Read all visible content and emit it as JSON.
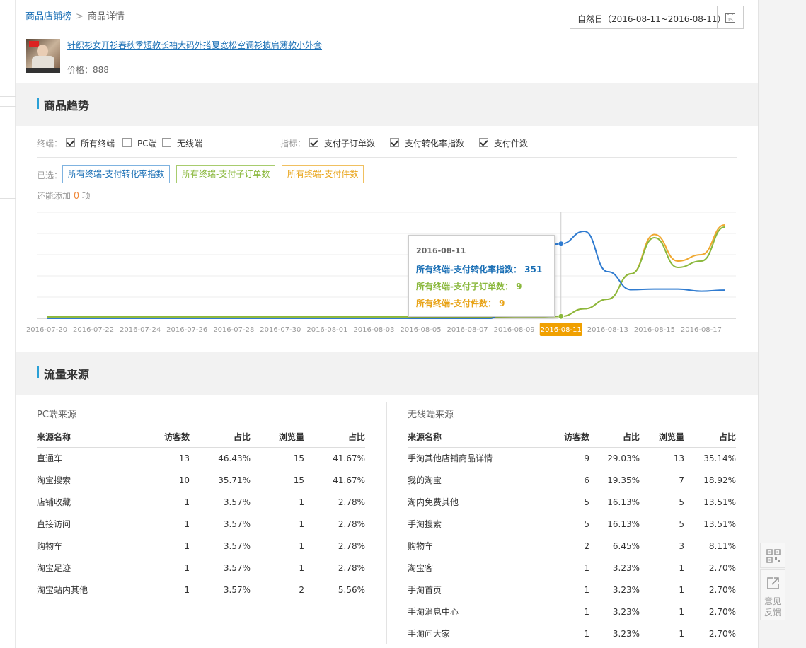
{
  "breadcrumb": {
    "root": "商品店铺榜",
    "current": "商品详情"
  },
  "date_range": "自然日（2016-08-11~2016-08-11）",
  "product": {
    "title": "针织衫女开衫春秋季短款长袖大码外搭夏宽松空调衫披肩薄款小外套",
    "price_label": "价格：",
    "price": "888"
  },
  "trend_section": {
    "title": "商品趋势"
  },
  "filters": {
    "terminal_label": "终端：",
    "terminals": [
      {
        "label": "所有终端",
        "checked": true
      },
      {
        "label": "PC端",
        "checked": false
      },
      {
        "label": "无线端",
        "checked": false
      }
    ],
    "metric_label": "指标：",
    "metrics": [
      {
        "label": "支付子订单数",
        "checked": true
      },
      {
        "label": "支付转化率指数",
        "checked": true
      },
      {
        "label": "支付件数",
        "checked": true
      }
    ]
  },
  "selected": {
    "label": "已选：",
    "tags": [
      "所有终端-支付转化率指数",
      "所有终端-支付子订单数",
      "所有终端-支付件数"
    ],
    "add_prefix": "还能添加",
    "add_count": "0",
    "add_suffix": "项"
  },
  "chart_data": {
    "type": "line",
    "x": [
      "2016-07-20",
      "2016-07-21",
      "2016-07-22",
      "2016-07-23",
      "2016-07-24",
      "2016-07-25",
      "2016-07-26",
      "2016-07-27",
      "2016-07-28",
      "2016-07-29",
      "2016-07-30",
      "2016-07-31",
      "2016-08-01",
      "2016-08-02",
      "2016-08-03",
      "2016-08-04",
      "2016-08-05",
      "2016-08-06",
      "2016-08-07",
      "2016-08-08",
      "2016-08-09",
      "2016-08-10",
      "2016-08-11",
      "2016-08-12",
      "2016-08-13",
      "2016-08-14",
      "2016-08-15",
      "2016-08-16",
      "2016-08-17",
      "2016-08-18"
    ],
    "tick_labels": [
      "2016-07-20",
      "2016-07-22",
      "2016-07-24",
      "2016-07-26",
      "2016-07-28",
      "2016-07-30",
      "2016-08-01",
      "2016-08-03",
      "2016-08-05",
      "2016-08-07",
      "2016-08-09",
      "2016-08-11",
      "2016-08-13",
      "2016-08-15",
      "2016-08-17"
    ],
    "highlighted_x": "2016-08-11",
    "ylim": [
      0,
      500
    ],
    "series": [
      {
        "name": "所有终端-支付转化率指数",
        "color": "#2f7bd0",
        "values": [
          0,
          0,
          0,
          0,
          0,
          0,
          0,
          0,
          0,
          0,
          0,
          0,
          0,
          0,
          0,
          0,
          0,
          0,
          0,
          0,
          180,
          340,
          351,
          410,
          220,
          135,
          138,
          138,
          128,
          133
        ]
      },
      {
        "name": "所有终端-支付子订单数",
        "color": "#8ab83c",
        "values": [
          7,
          7,
          7,
          7,
          7,
          7,
          7,
          7,
          7,
          7,
          7,
          7,
          7,
          7,
          7,
          7,
          7,
          7,
          7,
          7,
          8,
          8,
          9,
          45,
          90,
          210,
          380,
          240,
          270,
          430
        ]
      },
      {
        "name": "所有终端-支付件数",
        "color": "#f0a830",
        "values": [
          7,
          7,
          7,
          7,
          7,
          7,
          7,
          7,
          7,
          7,
          7,
          7,
          7,
          7,
          7,
          7,
          7,
          7,
          7,
          7,
          8,
          8,
          9,
          45,
          90,
          210,
          395,
          270,
          300,
          440
        ]
      }
    ],
    "tooltip": {
      "date": "2016-08-11",
      "rows": [
        {
          "label": "所有终端-支付转化率指数：",
          "value": "351"
        },
        {
          "label": "所有终端-支付子订单数：",
          "value": "9"
        },
        {
          "label": "所有终端-支付件数：",
          "value": "9"
        }
      ]
    }
  },
  "traffic_section": {
    "title": "流量来源"
  },
  "pc_sources": {
    "title": "PC端来源",
    "headers": [
      "来源名称",
      "访客数",
      "占比",
      "浏览量",
      "占比"
    ],
    "rows": [
      [
        "直通车",
        "13",
        "46.43%",
        "15",
        "41.67%"
      ],
      [
        "淘宝搜索",
        "10",
        "35.71%",
        "15",
        "41.67%"
      ],
      [
        "店铺收藏",
        "1",
        "3.57%",
        "1",
        "2.78%"
      ],
      [
        "直接访问",
        "1",
        "3.57%",
        "1",
        "2.78%"
      ],
      [
        "购物车",
        "1",
        "3.57%",
        "1",
        "2.78%"
      ],
      [
        "淘宝足迹",
        "1",
        "3.57%",
        "1",
        "2.78%"
      ],
      [
        "淘宝站内其他",
        "1",
        "3.57%",
        "2",
        "5.56%"
      ]
    ]
  },
  "wireless_sources": {
    "title": "无线端来源",
    "headers": [
      "来源名称",
      "访客数",
      "占比",
      "浏览量",
      "占比"
    ],
    "rows": [
      [
        "手淘其他店铺商品详情",
        "9",
        "29.03%",
        "13",
        "35.14%"
      ],
      [
        "我的淘宝",
        "6",
        "19.35%",
        "7",
        "18.92%"
      ],
      [
        "淘内免费其他",
        "5",
        "16.13%",
        "5",
        "13.51%"
      ],
      [
        "手淘搜索",
        "5",
        "16.13%",
        "5",
        "13.51%"
      ],
      [
        "购物车",
        "2",
        "6.45%",
        "3",
        "8.11%"
      ],
      [
        "淘宝客",
        "1",
        "3.23%",
        "1",
        "2.70%"
      ],
      [
        "手淘首页",
        "1",
        "3.23%",
        "1",
        "2.70%"
      ],
      [
        "手淘消息中心",
        "1",
        "3.23%",
        "1",
        "2.70%"
      ],
      [
        "手淘问大家",
        "1",
        "3.23%",
        "1",
        "2.70%"
      ]
    ]
  },
  "side_tools": {
    "qr_icon": "qr-code-icon",
    "feedback_icon": "share-icon",
    "feedback_label": "意见反馈"
  }
}
